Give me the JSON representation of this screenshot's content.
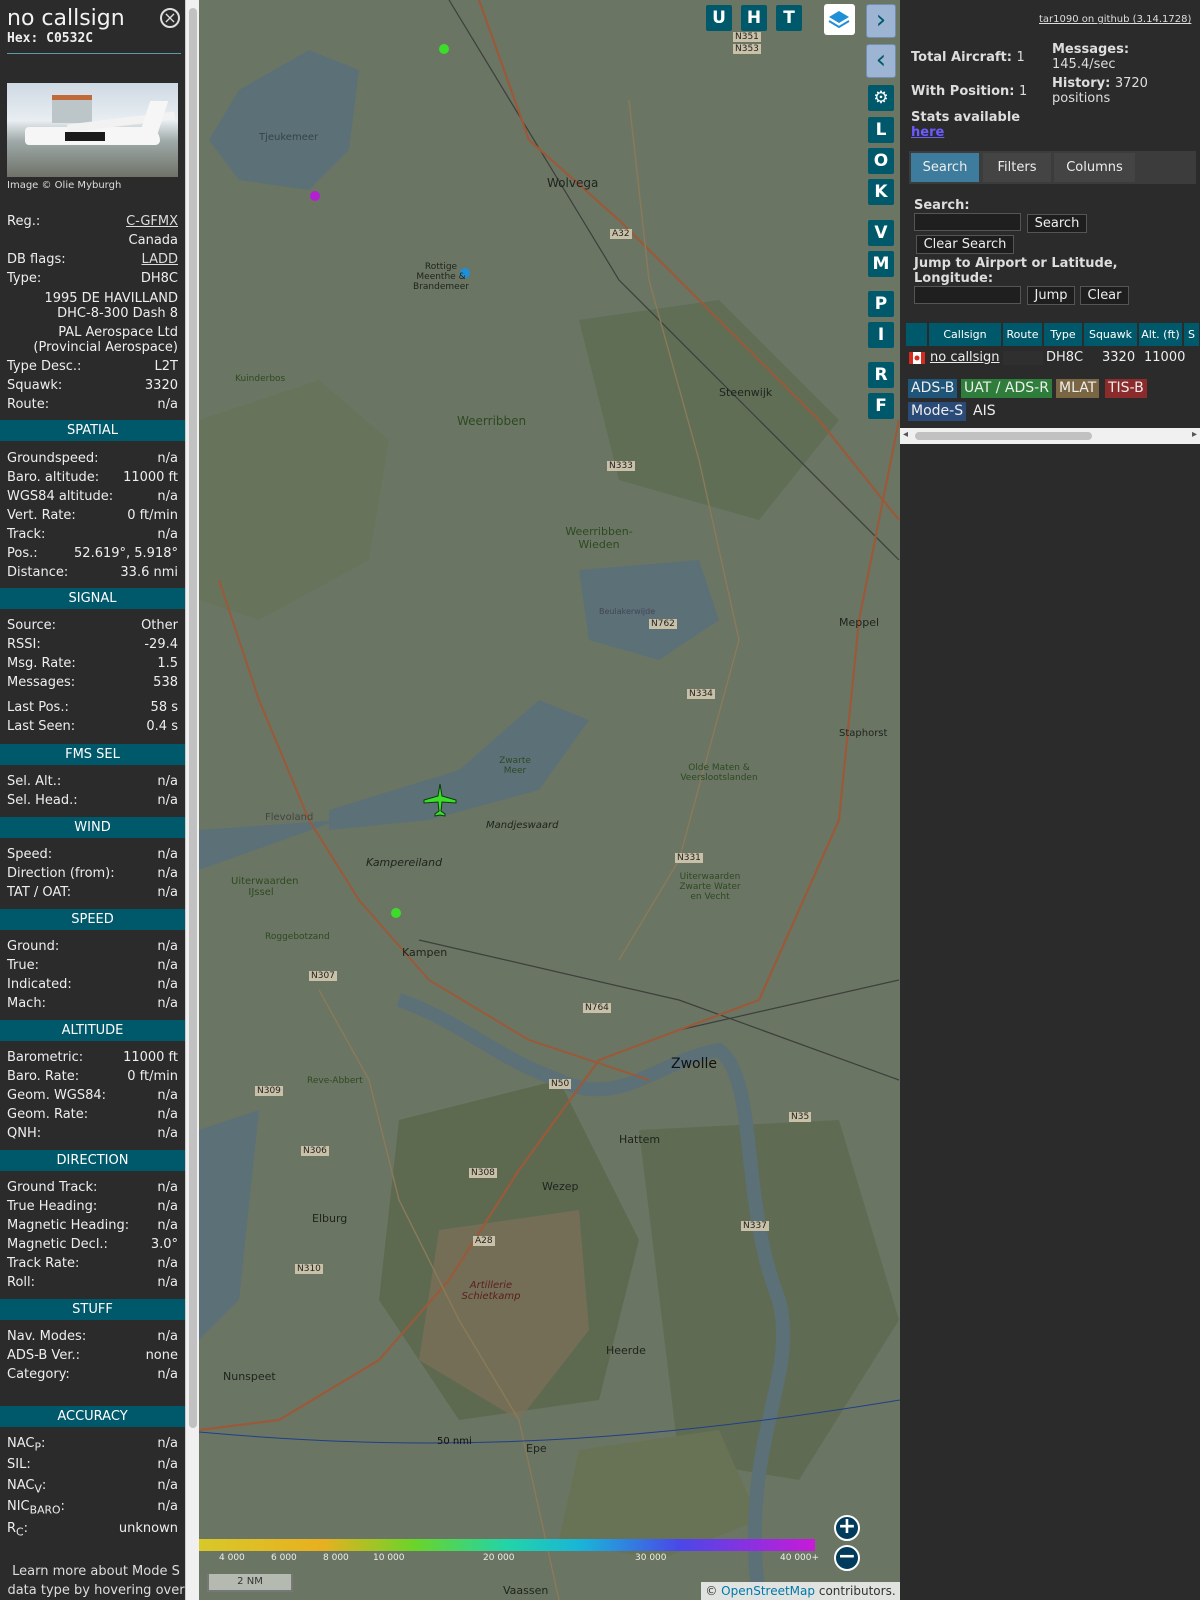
{
  "sidebar": {
    "callsign": "no callsign",
    "hex_label": "Hex:",
    "hex": "C0532C",
    "close_icon": "close-icon",
    "photo_credit": "Image © Olie Myburgh",
    "reg_label": "Reg.:",
    "reg": "C-GFMX",
    "country": "Canada",
    "db_flags_label": "DB flags:",
    "db_flags": "LADD",
    "type_label": "Type:",
    "type": "DH8C",
    "model_line1": "1995 DE HAVILLAND",
    "model_line2": "DHC-8-300 Dash 8",
    "owner_line1": "PAL Aerospace Ltd",
    "owner_line2": "(Provincial Aerospace)",
    "type_desc_label": "Type Desc.:",
    "type_desc": "L2T",
    "squawk_label": "Squawk:",
    "squawk": "3320",
    "route_label": "Route:",
    "route": "n/a",
    "sections": {
      "spatial": "SPATIAL",
      "signal": "SIGNAL",
      "fms": "FMS SEL",
      "wind": "WIND",
      "speed": "SPEED",
      "altitude": "ALTITUDE",
      "direction": "DIRECTION",
      "stuff": "STUFF",
      "accuracy": "ACCURACY"
    },
    "spatial": {
      "groundspeed_label": "Groundspeed:",
      "groundspeed": "n/a",
      "baro_alt_label": "Baro. altitude:",
      "baro_alt": "11000 ft",
      "wgs_alt_label": "WGS84 altitude:",
      "wgs_alt": "n/a",
      "vert_rate_label": "Vert. Rate:",
      "vert_rate": "0 ft/min",
      "track_label": "Track:",
      "track": "n/a",
      "pos_label": "Pos.:",
      "pos": "52.619°, 5.918°",
      "distance_label": "Distance:",
      "distance": "33.6 nmi"
    },
    "signal": {
      "source_label": "Source:",
      "source": "Other",
      "rssi_label": "RSSI:",
      "rssi": "-29.4",
      "msg_rate_label": "Msg. Rate:",
      "msg_rate": "1.5",
      "messages_label": "Messages:",
      "messages": "538",
      "last_pos_label": "Last Pos.:",
      "last_pos": "58 s",
      "last_seen_label": "Last Seen:",
      "last_seen": "0.4 s"
    },
    "fms": {
      "sel_alt_label": "Sel. Alt.:",
      "sel_alt": "n/a",
      "sel_head_label": "Sel. Head.:",
      "sel_head": "n/a"
    },
    "wind": {
      "speed_label": "Speed:",
      "speed": "n/a",
      "dir_label": "Direction (from):",
      "dir": "n/a",
      "tat_label": "TAT / OAT:",
      "tat": "n/a"
    },
    "speed": {
      "ground_label": "Ground:",
      "ground": "n/a",
      "true_label": "True:",
      "true": "n/a",
      "indicated_label": "Indicated:",
      "indicated": "n/a",
      "mach_label": "Mach:",
      "mach": "n/a"
    },
    "altitude": {
      "baro_label": "Barometric:",
      "baro": "11000 ft",
      "baro_rate_label": "Baro. Rate:",
      "baro_rate": "0 ft/min",
      "geom_label": "Geom. WGS84:",
      "geom": "n/a",
      "geom_rate_label": "Geom. Rate:",
      "geom_rate": "n/a",
      "qnh_label": "QNH:",
      "qnh": "n/a"
    },
    "direction": {
      "ground_track_label": "Ground Track:",
      "ground_track": "n/a",
      "true_heading_label": "True Heading:",
      "true_heading": "n/a",
      "mag_heading_label": "Magnetic Heading:",
      "mag_heading": "n/a",
      "mag_decl_label": "Magnetic Decl.:",
      "mag_decl": "3.0°",
      "track_rate_label": "Track Rate:",
      "track_rate": "n/a",
      "roll_label": "Roll:",
      "roll": "n/a"
    },
    "stuff": {
      "nav_modes_label": "Nav. Modes:",
      "nav_modes": "n/a",
      "adsb_ver_label": "ADS-B Ver.:",
      "adsb_ver": "none",
      "category_label": "Category:",
      "category": "n/a"
    },
    "accuracy": {
      "nacp_label": "NAC",
      "nacp_sub": "P",
      "nacp": "n/a",
      "sil_label": "SIL:",
      "sil": "n/a",
      "nacv_label": "NAC",
      "nacv_sub": "V",
      "nacv": "n/a",
      "nicbaro_label": "NIC",
      "nicbaro_sub": "BARO",
      "nicbaro": "n/a",
      "rc_label": "R",
      "rc_sub": "C",
      "rc": "unknown"
    },
    "footer": "Learn more about Mode S data type by hovering over"
  },
  "map": {
    "controls_top": [
      "U",
      "H",
      "T"
    ],
    "controls_side": [
      "L",
      "O",
      "K",
      "V",
      "M",
      "P",
      "I",
      "R",
      "F"
    ],
    "place_labels": [
      {
        "name": "Wolvega"
      },
      {
        "name": "Tjeukemeer"
      },
      {
        "name": "Rottige Meenthe & Brandemeer"
      },
      {
        "name": "Weerribben"
      },
      {
        "name": "Steenwijk"
      },
      {
        "name": "Weerribben-Wieden"
      },
      {
        "name": "Beulakerwijde"
      },
      {
        "name": "Meppel"
      },
      {
        "name": "Staphorst"
      },
      {
        "name": "Zwarte Meer"
      },
      {
        "name": "Mandjeswaard"
      },
      {
        "name": "Kampereiland"
      },
      {
        "name": "Olde Maten & Veerslootslanden"
      },
      {
        "name": "Kampen"
      },
      {
        "name": "Zwolle"
      },
      {
        "name": "Hattem"
      },
      {
        "name": "Wezep"
      },
      {
        "name": "Elburg"
      },
      {
        "name": "Artillerie Schietkamp"
      },
      {
        "name": "Heerde"
      },
      {
        "name": "Nunspeet"
      },
      {
        "name": "Epe"
      },
      {
        "name": "Vaassen"
      },
      {
        "name": "Kuinderbos"
      },
      {
        "name": "Flevoland"
      },
      {
        "name": "Roggebotzand"
      },
      {
        "name": "Reve-Abbert"
      },
      {
        "name": "Uiterwaarden IJssel"
      },
      {
        "name": "Uiterwaarden Zwarte Water en Vecht"
      }
    ],
    "road_labels": [
      "N351",
      "N353",
      "A32",
      "N333",
      "N762",
      "N334",
      "N331",
      "N307",
      "N764",
      "N50",
      "N309",
      "N306",
      "N308",
      "N35",
      "N337",
      "N310",
      "A28"
    ],
    "range_ring_label": "50 nmi",
    "altitude_scale": [
      "4 000",
      "6 000",
      "8 000",
      "10 000",
      "20 000",
      "30 000",
      "40 000+"
    ],
    "scale_bar": "2 NM",
    "attribution_prefix": "©",
    "attribution_link": "OpenStreetMap",
    "attribution_suffix": "contributors.",
    "zoom_in": "+",
    "zoom_out": "−"
  },
  "panel": {
    "github_link": "tar1090 on github (3.14.1728)",
    "total_aircraft_label": "Total Aircraft:",
    "total_aircraft": "1",
    "with_position_label": "With Position:",
    "with_position": "1",
    "messages_label": "Messages:",
    "messages": "145.4/sec",
    "history_label": "History:",
    "history": "3720 positions",
    "stats_label": "Stats available",
    "stats_link": "here",
    "tabs": [
      "Search",
      "Filters",
      "Columns"
    ],
    "search_label": "Search:",
    "search_button": "Search",
    "clear_search_button": "Clear Search",
    "jump_label": "Jump to Airport or Latitude, Longitude:",
    "jump_button": "Jump",
    "clear_button": "Clear",
    "table_headers": [
      "Callsign",
      "Route",
      "Type",
      "Squawk",
      "Alt. (ft)",
      "S"
    ],
    "table_row": {
      "callsign": "no callsign",
      "route": "",
      "type": "DH8C",
      "squawk": "3320",
      "alt": "11000"
    },
    "legend": [
      "ADS-B",
      "UAT / ADS-R",
      "MLAT",
      "TIS-B",
      "Mode-S",
      "AIS"
    ]
  },
  "colors": {
    "section_bg": "#00596b",
    "aircraft": "#3ddc2b",
    "adsb": "#1f5578",
    "uat": "#2e7d3a",
    "mlat": "#7a6642",
    "tisb": "#8b2b2b",
    "modes": "#2a4a78"
  }
}
